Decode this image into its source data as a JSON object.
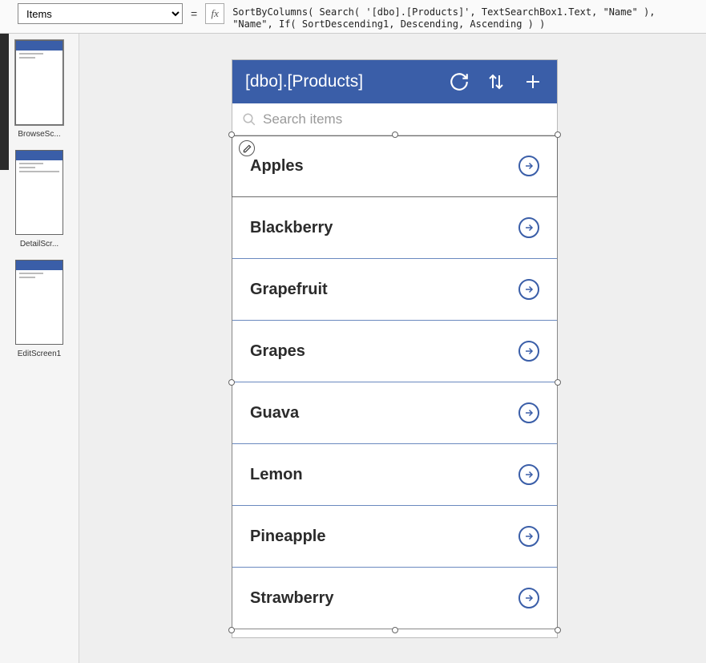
{
  "formulaBar": {
    "property": "Items",
    "equals": "=",
    "fx": "fx",
    "formula": "SortByColumns( Search( '[dbo].[Products]', TextSearchBox1.Text, \"Name\" ),\n\"Name\", If( SortDescending1, Descending, Ascending ) )"
  },
  "thumbnails": [
    {
      "label": "BrowseSc...",
      "selected": true
    },
    {
      "label": "DetailScr...",
      "selected": false
    },
    {
      "label": "EditScreen1",
      "selected": false
    }
  ],
  "phone": {
    "title": "[dbo].[Products]",
    "searchPlaceholder": "Search items",
    "items": [
      {
        "name": "Apples"
      },
      {
        "name": "Blackberry"
      },
      {
        "name": "Grapefruit"
      },
      {
        "name": "Grapes"
      },
      {
        "name": "Guava"
      },
      {
        "name": "Lemon"
      },
      {
        "name": "Pineapple"
      },
      {
        "name": "Strawberry"
      }
    ]
  }
}
